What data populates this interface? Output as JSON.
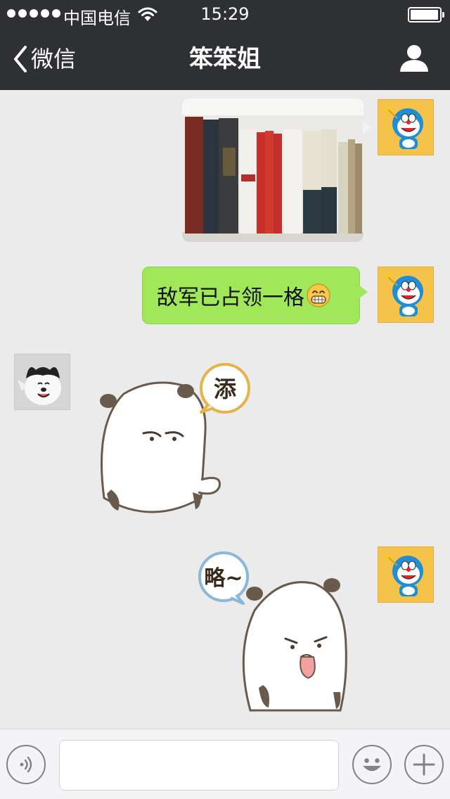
{
  "status_bar": {
    "carrier": "中国电信",
    "time": "15:29",
    "signal_icon": "signal-dots-icon",
    "wifi_icon": "wifi-icon",
    "battery_icon": "battery-icon"
  },
  "nav": {
    "back_label": "微信",
    "title": "笨笨姐",
    "profile_icon": "person-icon"
  },
  "messages": [
    {
      "sender": "me",
      "type": "image",
      "content": "bookshelf-photo"
    },
    {
      "sender": "me",
      "type": "text",
      "text": "敌军已占领一格",
      "emoji": "grinning-face-emoji"
    },
    {
      "sender": "friend",
      "type": "sticker",
      "content": "bear-sticker-tian",
      "sticker_text": "添"
    },
    {
      "sender": "me",
      "type": "sticker",
      "content": "bear-sticker-lue",
      "sticker_text": "略~"
    }
  ],
  "input_bar": {
    "voice_icon": "voice-icon",
    "input_value": "",
    "emoji_icon": "smiley-icon",
    "plus_icon": "plus-icon"
  },
  "colors": {
    "header_bg": "#2e3033",
    "chat_bg": "#ebebeb",
    "my_bubble": "#a0e75a",
    "input_bar_bg": "#f4f4f6"
  }
}
